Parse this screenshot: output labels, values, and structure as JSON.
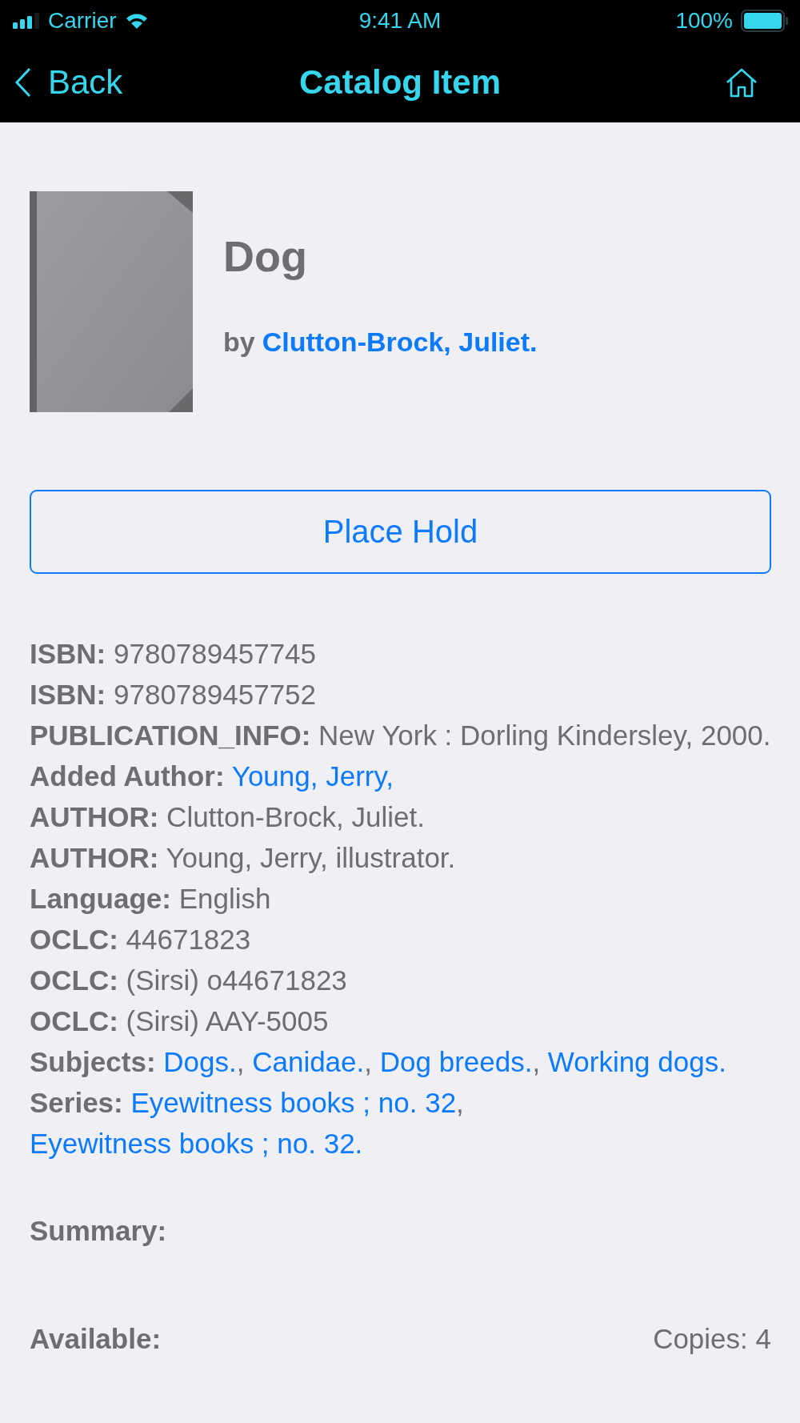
{
  "status_bar": {
    "carrier": "Carrier",
    "time": "9:41 AM",
    "battery": "100%"
  },
  "nav_bar": {
    "back": "Back",
    "title": "Catalog Item"
  },
  "item": {
    "title": "Dog",
    "by": "by",
    "author": "Clutton-Brock, Juliet."
  },
  "place_hold_button": "Place Hold",
  "fields": [
    {
      "kind": "text",
      "label": "ISBN:",
      "value": "9780789457745"
    },
    {
      "kind": "text",
      "label": "ISBN:",
      "value": "9780789457752"
    },
    {
      "kind": "text",
      "label": "PUBLICATION_INFO:",
      "value": "New York : Dorling Kindersley, 2000."
    },
    {
      "kind": "links",
      "label": "Added Author:",
      "links": [
        "Young, Jerry,"
      ]
    },
    {
      "kind": "text",
      "label": "AUTHOR:",
      "value": "Clutton-Brock, Juliet."
    },
    {
      "kind": "text",
      "label": "AUTHOR:",
      "value": "Young, Jerry, illustrator."
    },
    {
      "kind": "text",
      "label": "Language:",
      "value": "English"
    },
    {
      "kind": "text",
      "label": "OCLC:",
      "value": "44671823"
    },
    {
      "kind": "text",
      "label": "OCLC:",
      "value": "(Sirsi) o44671823"
    },
    {
      "kind": "text",
      "label": "OCLC:",
      "value": "(Sirsi) AAY-5005"
    },
    {
      "kind": "links",
      "label": "Subjects:",
      "separator": ", ",
      "links": [
        "Dogs.",
        "Canidae.",
        "Dog breeds.",
        "Working dogs."
      ]
    },
    {
      "kind": "links",
      "label": "Series:",
      "separator": ", ",
      "links": [
        "Eyewitness books ; no. 32",
        "Eyewitness books ; no. 32."
      ]
    }
  ],
  "summary": {
    "label": "Summary:"
  },
  "availability": {
    "label": "Available:",
    "copies": "Copies: 4"
  }
}
